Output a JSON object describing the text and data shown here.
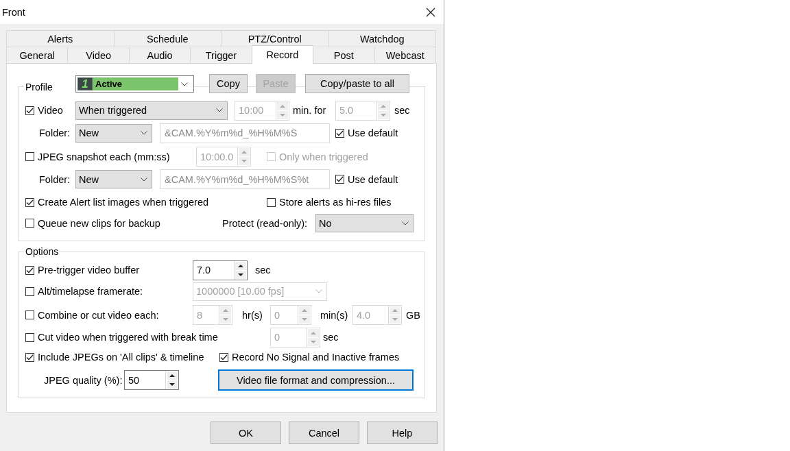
{
  "window": {
    "title": "Front"
  },
  "tab_rows": [
    [
      {
        "label": "Alerts",
        "selected": false
      },
      {
        "label": "Schedule",
        "selected": false
      },
      {
        "label": "PTZ/Control",
        "selected": false
      },
      {
        "label": "Watchdog",
        "selected": false
      }
    ],
    [
      {
        "label": "General",
        "selected": false
      },
      {
        "label": "Video",
        "selected": false
      },
      {
        "label": "Audio",
        "selected": false
      },
      {
        "label": "Trigger",
        "selected": false
      },
      {
        "label": "Record",
        "selected": true
      },
      {
        "label": "Post",
        "selected": false
      },
      {
        "label": "Webcast",
        "selected": false
      }
    ]
  ],
  "profile": {
    "legend": "Profile",
    "number": "1",
    "value": "Active"
  },
  "profile_buttons": [
    {
      "label": "Copy",
      "disabled": false
    },
    {
      "label": "Paste",
      "disabled": true
    },
    {
      "label": "Copy/paste to all",
      "disabled": false
    }
  ],
  "video": {
    "label": "Video",
    "checked": true
  },
  "video_mode": {
    "value": "When triggered",
    "disabled": false
  },
  "video_interval": {
    "value": "10:00",
    "disabled": true
  },
  "video_interval_unit": "min. for",
  "video_duration": {
    "value": "5.0",
    "disabled": true
  },
  "video_duration_unit": "sec",
  "video_folder": {
    "label": "Folder:",
    "type": {
      "value": "New",
      "disabled": false
    },
    "path": {
      "value": "&CAM.%Y%m%d_%H%M%S",
      "disabled": true
    },
    "use_default": {
      "label": "Use default",
      "checked": true
    }
  },
  "jpeg_snapshot": {
    "label": "JPEG snapshot each (mm:ss)",
    "checked": false
  },
  "jpeg_interval": {
    "value": "10:00.0",
    "disabled": true
  },
  "only_when_triggered": {
    "label": "Only when triggered",
    "checked": false,
    "disabled": true
  },
  "jpeg_folder": {
    "label": "Folder:",
    "type": {
      "value": "New",
      "disabled": false
    },
    "path": {
      "value": "&CAM.%Y%m%d_%H%M%S%t",
      "disabled": true
    },
    "use_default": {
      "label": "Use default",
      "checked": true
    }
  },
  "create_alert_images": {
    "label": "Create Alert list images when triggered",
    "checked": true
  },
  "store_hires": {
    "label": "Store alerts as hi-res files",
    "checked": false
  },
  "queue_backup": {
    "label": "Queue new clips for backup",
    "checked": false
  },
  "protect": {
    "label": "Protect (read-only):",
    "value": "No",
    "disabled": false
  },
  "options_legend": "Options",
  "pre_trigger": {
    "label": "Pre-trigger video buffer",
    "checked": true
  },
  "pre_trigger_value": {
    "value": "7.0",
    "disabled": false
  },
  "pre_trigger_unit": "sec",
  "alt_framerate": {
    "label": "Alt/timelapse framerate:",
    "checked": false
  },
  "alt_framerate_value": {
    "value": "1000000 [10.00 fps]",
    "disabled": true
  },
  "combine": {
    "label": "Combine or cut video each:",
    "checked": false
  },
  "combine_hours": {
    "value": "8",
    "disabled": true
  },
  "hours_unit": "hr(s)",
  "combine_minutes": {
    "value": "0",
    "disabled": true
  },
  "minutes_unit": "min(s)",
  "combine_size": {
    "value": "4.0",
    "disabled": true
  },
  "size_unit": "GB",
  "cut_break": {
    "label": "Cut video when triggered with break time",
    "checked": false
  },
  "break_time": {
    "value": "0",
    "disabled": true
  },
  "break_unit": "sec",
  "include_jpegs": {
    "label": "Include JPEGs on 'All clips' & timeline",
    "checked": true
  },
  "record_no_signal": {
    "label": "Record No Signal and Inactive frames",
    "checked": true
  },
  "jpeg_quality": {
    "label": "JPEG quality (%):",
    "value": "50",
    "disabled": false
  },
  "compression_button": {
    "label": "Video file format and compression...",
    "focused": true
  },
  "dialog_buttons": [
    {
      "label": "OK"
    },
    {
      "label": "Cancel"
    },
    {
      "label": "Help"
    }
  ]
}
